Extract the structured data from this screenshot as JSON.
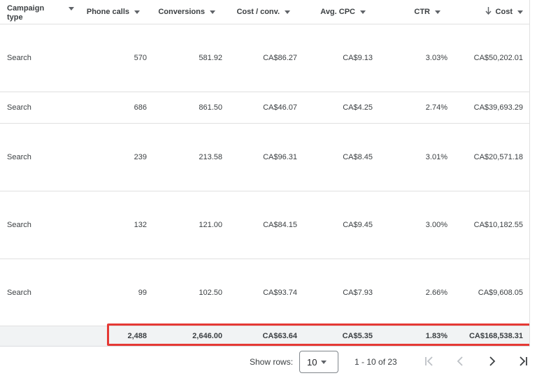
{
  "table": {
    "headers": [
      "Campaign type",
      "Phone calls",
      "Conversions",
      "Cost / conv.",
      "Avg. CPC",
      "CTR",
      "Cost"
    ],
    "header_line1": "Campaign",
    "header_line2": "type",
    "sorted_column": "Cost",
    "sort_direction": "descending",
    "rows": [
      [
        "Search",
        "570",
        "581.92",
        "CA$86.27",
        "CA$9.13",
        "3.03%",
        "CA$50,202.01"
      ],
      [
        "Search",
        "686",
        "861.50",
        "CA$46.07",
        "CA$4.25",
        "2.74%",
        "CA$39,693.29"
      ],
      [
        "Search",
        "239",
        "213.58",
        "CA$96.31",
        "CA$8.45",
        "3.01%",
        "CA$20,571.18"
      ],
      [
        "Search",
        "132",
        "121.00",
        "CA$84.15",
        "CA$9.45",
        "3.00%",
        "CA$10,182.55"
      ],
      [
        "Search",
        "99",
        "102.50",
        "CA$93.74",
        "CA$7.93",
        "2.66%",
        "CA$9,608.05"
      ]
    ],
    "totals": [
      "",
      "2,488",
      "2,646.00",
      "CA$63.64",
      "CA$5.35",
      "1.83%",
      "CA$168,538.31"
    ]
  },
  "pager": {
    "show_rows_label": "Show rows:",
    "rows_per_page": "10",
    "range_text": "1 - 10 of 23"
  },
  "colors": {
    "highlight_border": "#e53935",
    "totals_background": "#f1f3f4",
    "divider": "#e0e0e0"
  },
  "icons": [
    "dropdown-triangle-icon",
    "sort-descending-arrow-icon",
    "first-page-icon",
    "previous-page-icon",
    "next-page-icon",
    "last-page-icon"
  ]
}
